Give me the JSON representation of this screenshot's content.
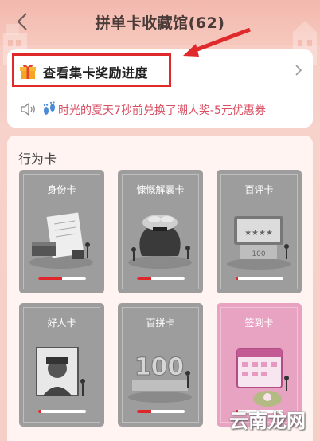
{
  "header": {
    "title": "拼单卡收藏馆(62)"
  },
  "progress_entry": {
    "label": "查看集卡奖励进度"
  },
  "notice": {
    "text": "时光的夏天7秒前兑换了潮人奖-5元优惠券"
  },
  "section": {
    "title": "行为卡"
  },
  "cards": [
    {
      "name": "身份卡",
      "progress": 0.5
    },
    {
      "name": "慷慨解囊卡",
      "progress": 0.3
    },
    {
      "name": "百评卡",
      "progress": 0.05
    },
    {
      "name": "好人卡",
      "progress": 0.05
    },
    {
      "name": "百拼卡",
      "progress": 0.3
    },
    {
      "name": "签到卡",
      "progress": 0.05
    }
  ],
  "watermark": {
    "text": "云南龙网"
  },
  "colors": {
    "accent_red": "#e0292b",
    "notice_pink": "#d94e62",
    "card_gray": "#9d9d9d",
    "card_pink": "#e8a3c2"
  }
}
